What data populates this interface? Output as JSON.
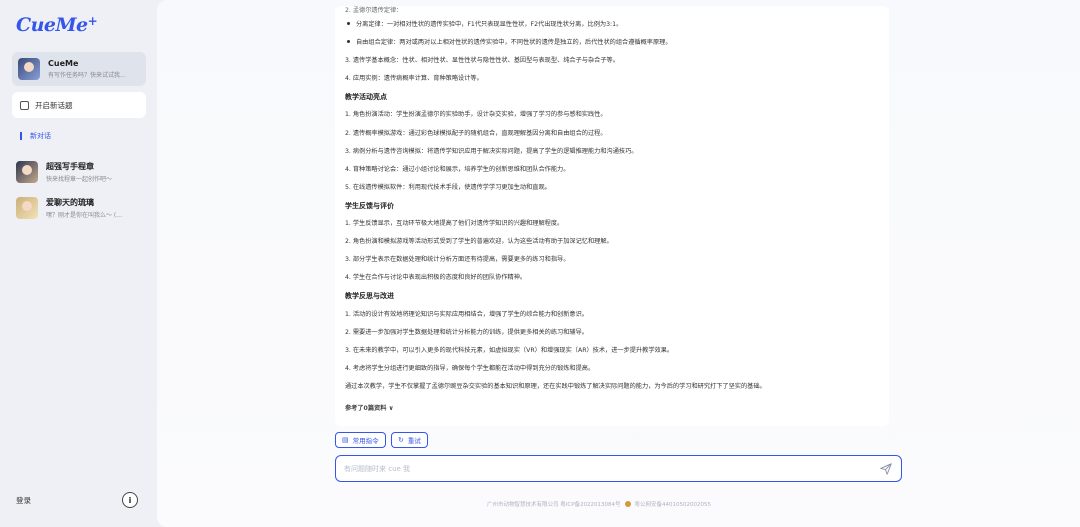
{
  "sidebar": {
    "logo": "CueMe",
    "logo_plus": "+",
    "agent": {
      "title": "CueMe",
      "subtitle": "有写作任务吗？快来试试我..."
    },
    "new_chat_label": "开启新话题",
    "section_label": "新对话",
    "chats": [
      {
        "title": "超强写手程章",
        "subtitle": "快来找程章一起创作吧～"
      },
      {
        "title": "爱聊天的琉璃",
        "subtitle": "嘿？刚才是你在叫我么～ (..."
      }
    ],
    "login_label": "登录",
    "info_glyph": "i"
  },
  "document": {
    "lines": [
      {
        "kind": "cut",
        "text": "2. 孟德尔遗传定律："
      },
      {
        "kind": "bullet",
        "text": "分离定律：一对相对性状的遗传实验中，F1代只表现显性性状，F2代出现性状分离，比例为3:1。"
      },
      {
        "kind": "bullet",
        "text": "自由组合定律：两对或两对以上相对性状的遗传实验中，不同性状的遗传是独立的，后代性状的组合遵循概率原理。"
      },
      {
        "kind": "text",
        "text": "3. 遗传学基本概念：性状、相对性状、显性性状与隐性性状、基因型与表现型、纯合子与杂合子等。"
      },
      {
        "kind": "text",
        "text": "4. 应用实例：遗传病概率计算、育种策略设计等。"
      },
      {
        "kind": "head",
        "text": "教学活动亮点"
      },
      {
        "kind": "text",
        "text": "1. 角色扮演活动：学生扮演孟德尔的实验助手，设计杂交实验，增强了学习的参与感和实践性。"
      },
      {
        "kind": "text",
        "text": "2. 遗传概率模拟游戏：通过彩色球模拟配子的随机组合，直观理解基因分离和自由组合的过程。"
      },
      {
        "kind": "text",
        "text": "3. 病例分析与遗传咨询模拟：将遗传学知识应用于解决实际问题，提高了学生的逻辑推理能力和沟通技巧。"
      },
      {
        "kind": "text",
        "text": "4. 育种策略讨论会：通过小组讨论和展示，培养学生的创新思维和团队合作能力。"
      },
      {
        "kind": "text",
        "text": "5. 在线遗传模拟软件：利用现代技术手段，使遗传学学习更加生动和直观。"
      },
      {
        "kind": "head",
        "text": "学生反馈与评价"
      },
      {
        "kind": "text",
        "text": "1. 学生反馈显示，互动环节极大地提高了他们对遗传学知识的兴趣和理解程度。"
      },
      {
        "kind": "text",
        "text": "2. 角色扮演和模拟游戏等活动形式受到了学生的普遍欢迎，认为这些活动有助于加深记忆和理解。"
      },
      {
        "kind": "text",
        "text": "3. 部分学生表示在数据处理和统计分析方面还有待提高，需要更多的练习和指导。"
      },
      {
        "kind": "text",
        "text": "4. 学生在合作与讨论中表现出积极的态度和良好的团队协作精神。"
      },
      {
        "kind": "head",
        "text": "教学反思与改进"
      },
      {
        "kind": "text",
        "text": "1. 活动的设计有效地将理论知识与实际应用相结合，增强了学生的综合能力和创新意识。"
      },
      {
        "kind": "text",
        "text": "2. 需要进一步加强对学生数据处理和统计分析能力的训练，提供更多相关的练习和辅导。"
      },
      {
        "kind": "text",
        "text": "3. 在未来的教学中，可以引入更多的现代科技元素，如虚拟现实（VR）和增强现实（AR）技术，进一步提升教学效果。"
      },
      {
        "kind": "text",
        "text": "4. 考虑将学生分组进行更细致的指导，确保每个学生都能在活动中得到充分的锻炼和提高。"
      },
      {
        "kind": "text",
        "text": "通过本次教学，学生不仅掌握了孟德尔豌豆杂交实验的基本知识和原理，还在实践中锻炼了解决实际问题的能力，为今后的学习和研究打下了坚实的基础。"
      },
      {
        "kind": "cut2",
        "text": "参考了0篇资料 ∨"
      }
    ]
  },
  "actions": {
    "common_commands": "常用指令",
    "retry": "重试"
  },
  "input": {
    "placeholder": "有问题随时来 cue 我",
    "value": ""
  },
  "footer": {
    "company": "广州市动物智慧技术有限公司 粤ICP备2022013084号",
    "police": "粤公网安备44010502002055"
  },
  "colors": {
    "accent": "#3556e8"
  }
}
